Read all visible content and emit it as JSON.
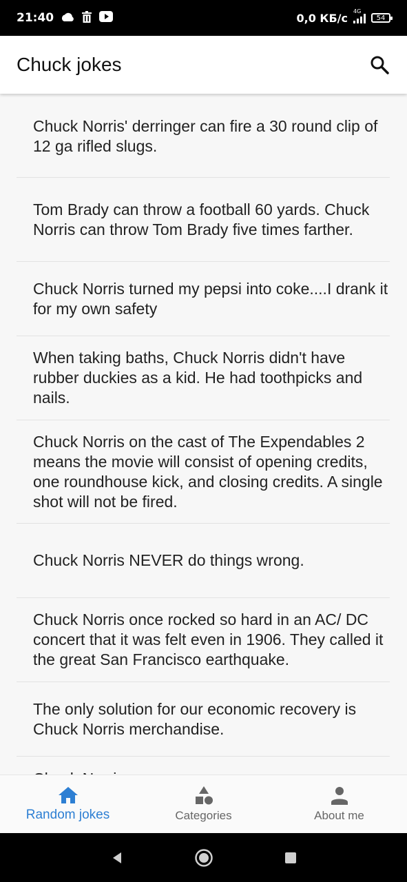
{
  "status_bar": {
    "time": "21:40",
    "speed": "0,0 КБ/с",
    "network": "4G",
    "battery": "54"
  },
  "app_bar": {
    "title": "Chuck jokes"
  },
  "jokes": [
    "Chuck Norris' derringer can fire a 30 round clip of 12 ga rifled slugs.",
    "Tom Brady can throw a football 60 yards. Chuck Norris can throw Tom Brady five times farther.",
    "Chuck Norris turned my pepsi into coke....I drank it for my own safety",
    "When taking baths, Chuck Norris didn't have rubber duckies as a kid. He had toothpicks and nails.",
    "Chuck Norris on the cast of The Expendables 2 means the movie will consist of opening credits, one roundhouse kick, and closing credits. A single shot will not be fired.",
    "Chuck Norris NEVER do things wrong.",
    "Chuck Norris once rocked so hard in an AC/ DC concert that it was felt even in 1906. They called it the great San Francisco earthquake.",
    "The only solution for our economic recovery is Chuck Norris merchandise.",
    "Chuck Norris ..."
  ],
  "bottom_nav": [
    {
      "label": "Random jokes",
      "icon": "home-icon",
      "active": true
    },
    {
      "label": "Categories",
      "icon": "categories-icon",
      "active": false
    },
    {
      "label": "About me",
      "icon": "person-icon",
      "active": false
    }
  ],
  "colors": {
    "accent": "#2d7fd3",
    "inactive": "#666666"
  }
}
